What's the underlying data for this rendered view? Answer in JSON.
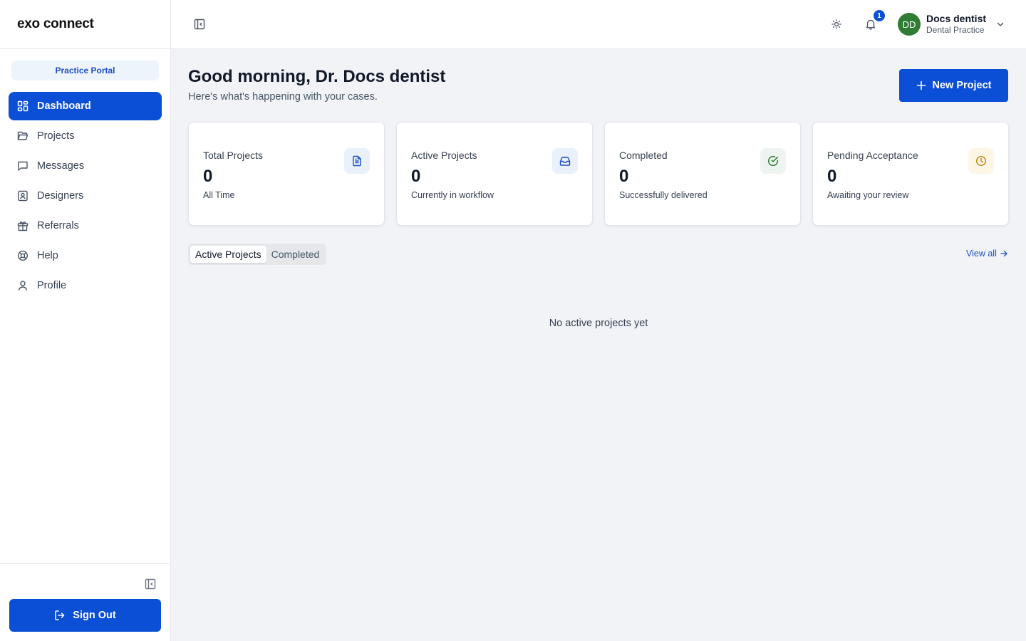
{
  "brand": {
    "name": "exo connect"
  },
  "sidebar": {
    "portal_label": "Practice Portal",
    "items": [
      {
        "label": "Dashboard",
        "icon": "dashboard-icon"
      },
      {
        "label": "Projects",
        "icon": "folder-icon"
      },
      {
        "label": "Messages",
        "icon": "message-icon"
      },
      {
        "label": "Designers",
        "icon": "contact-icon"
      },
      {
        "label": "Referrals",
        "icon": "gift-icon"
      },
      {
        "label": "Help",
        "icon": "lifebuoy-icon"
      },
      {
        "label": "Profile",
        "icon": "user-icon"
      }
    ],
    "sign_out_label": "Sign Out"
  },
  "header": {
    "notification_count": "1",
    "user": {
      "initials": "DD",
      "name": "Docs dentist",
      "role": "Dental Practice",
      "avatar_color": "#2e7d32"
    }
  },
  "main": {
    "greeting": "Good morning, Dr. Docs dentist",
    "subtitle": "Here's what's happening with your cases.",
    "new_project_label": "New Project",
    "stats": [
      {
        "label": "Total Projects",
        "value": "0",
        "sub": "All Time",
        "icon": "document-icon",
        "icon_color": "#1b4fc4",
        "icon_bg": "#eaf1fb"
      },
      {
        "label": "Active Projects",
        "value": "0",
        "sub": "Currently in workflow",
        "icon": "inbox-icon",
        "icon_color": "#1b4fc4",
        "icon_bg": "#eaf1fb"
      },
      {
        "label": "Completed",
        "value": "0",
        "sub": "Successfully delivered",
        "icon": "check-circle-icon",
        "icon_color": "#2e7d32",
        "icon_bg": "#eef5f0"
      },
      {
        "label": "Pending Acceptance",
        "value": "0",
        "sub": "Awaiting your review",
        "icon": "clock-icon",
        "icon_color": "#c28a1a",
        "icon_bg": "#fdf6e6"
      }
    ],
    "tabs": [
      {
        "label": "Active Projects"
      },
      {
        "label": "Completed"
      }
    ],
    "view_all_label": "View all",
    "empty_text": "No active projects yet"
  },
  "colors": {
    "primary": "#0b4fd6",
    "background": "#f1f3f7",
    "border": "#e5e7eb"
  }
}
